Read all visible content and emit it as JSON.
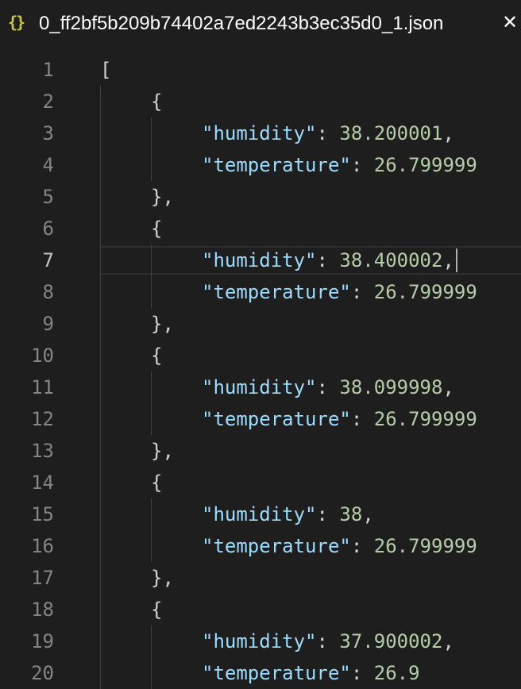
{
  "tab": {
    "icon": "{}",
    "title": "0_ff2bf5b209b74402a7ed2243b3ec35d0_1.json",
    "close": "✕"
  },
  "editor": {
    "active_line": 7,
    "lines": [
      {
        "n": "1",
        "indent": 0,
        "text": "["
      },
      {
        "n": "2",
        "indent": 1,
        "text": "{"
      },
      {
        "n": "3",
        "indent": 2,
        "key": "humidity",
        "value": "38.200001",
        "comma": true
      },
      {
        "n": "4",
        "indent": 2,
        "key": "temperature",
        "value": "26.799999",
        "comma": false
      },
      {
        "n": "5",
        "indent": 1,
        "text": "},"
      },
      {
        "n": "6",
        "indent": 1,
        "text": "{"
      },
      {
        "n": "7",
        "indent": 2,
        "key": "humidity",
        "value": "38.400002",
        "comma": true
      },
      {
        "n": "8",
        "indent": 2,
        "key": "temperature",
        "value": "26.799999",
        "comma": false
      },
      {
        "n": "9",
        "indent": 1,
        "text": "},"
      },
      {
        "n": "10",
        "indent": 1,
        "text": "{"
      },
      {
        "n": "11",
        "indent": 2,
        "key": "humidity",
        "value": "38.099998",
        "comma": true
      },
      {
        "n": "12",
        "indent": 2,
        "key": "temperature",
        "value": "26.799999",
        "comma": false
      },
      {
        "n": "13",
        "indent": 1,
        "text": "},"
      },
      {
        "n": "14",
        "indent": 1,
        "text": "{"
      },
      {
        "n": "15",
        "indent": 2,
        "key": "humidity",
        "value": "38",
        "comma": true
      },
      {
        "n": "16",
        "indent": 2,
        "key": "temperature",
        "value": "26.799999",
        "comma": false
      },
      {
        "n": "17",
        "indent": 1,
        "text": "},"
      },
      {
        "n": "18",
        "indent": 1,
        "text": "{"
      },
      {
        "n": "19",
        "indent": 2,
        "key": "humidity",
        "value": "37.900002",
        "comma": true
      },
      {
        "n": "20",
        "indent": 2,
        "key": "temperature",
        "value": "26.9",
        "comma": false
      }
    ]
  }
}
